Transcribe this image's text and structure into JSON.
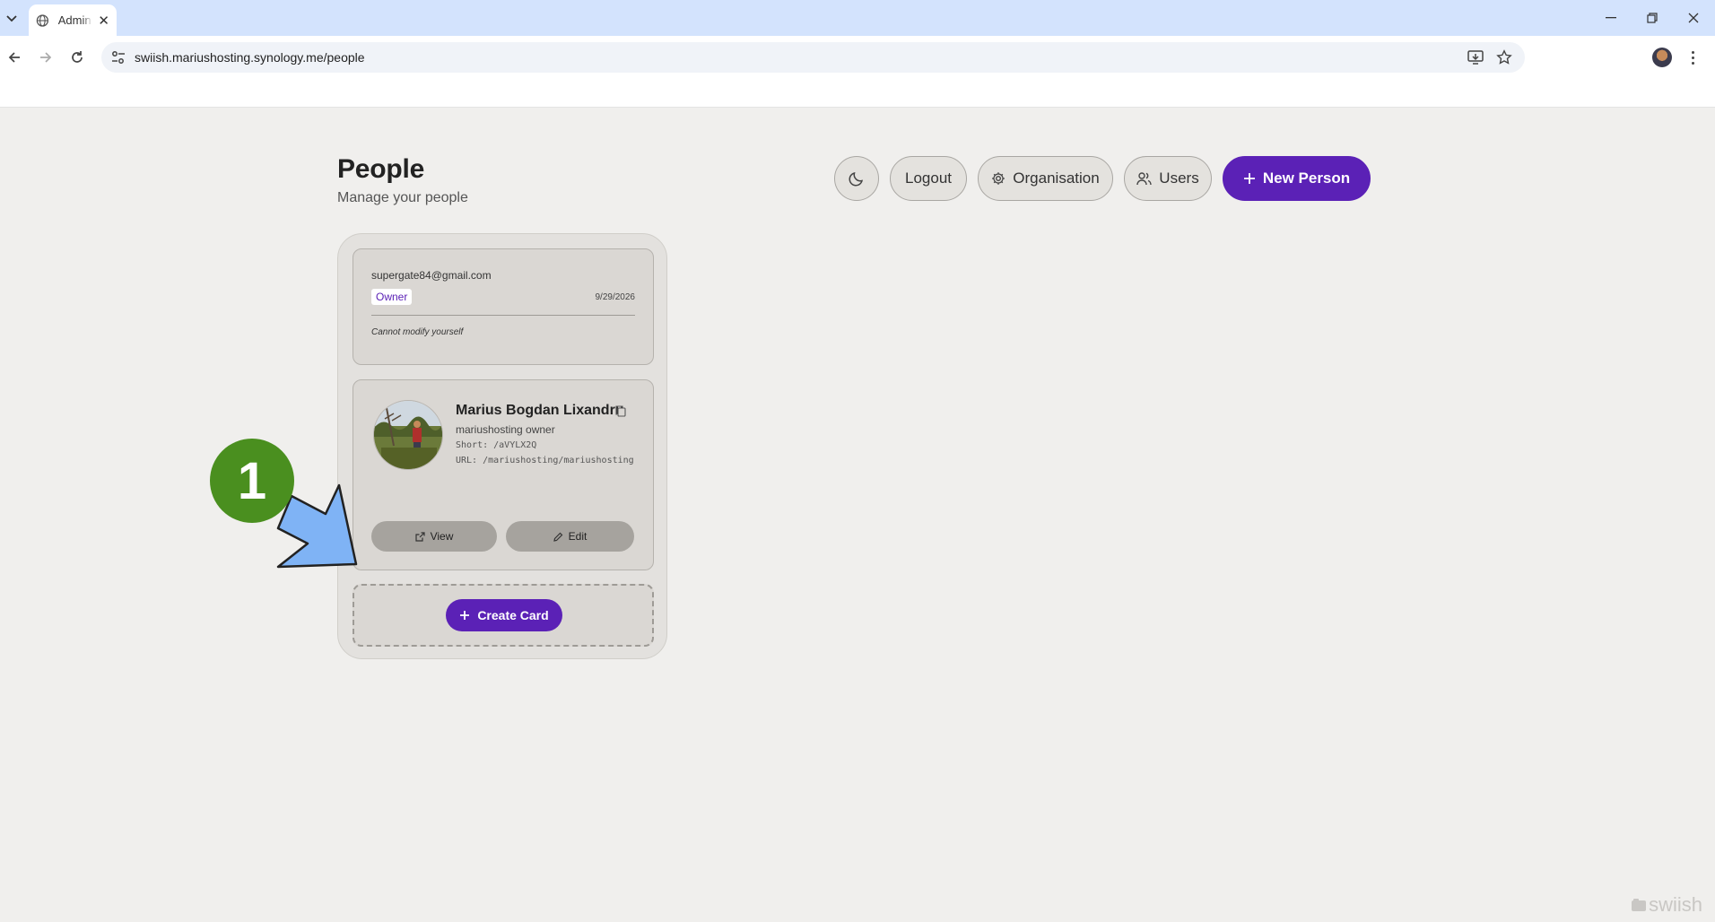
{
  "browser": {
    "tab_title": "Admin",
    "url": "swiish.mariushosting.synology.me/people"
  },
  "header": {
    "title": "People",
    "subtitle": "Manage your people",
    "buttons": {
      "logout": "Logout",
      "organisation": "Organisation",
      "users": "Users",
      "new_person": "New Person"
    }
  },
  "user_card": {
    "email": "supergate84@gmail.com",
    "role": "Owner",
    "date": "9/29/2026",
    "note": "Cannot modify yourself"
  },
  "person_card": {
    "name": "Marius Bogdan Lixandru",
    "title": "mariushosting owner",
    "short": "Short: /aVYLX2Q",
    "url": "URL: /mariushosting/mariushosting",
    "view_label": "View",
    "edit_label": "Edit"
  },
  "create_card": {
    "label": "Create Card"
  },
  "annotation": {
    "step": "1"
  },
  "watermark": "swiish",
  "colors": {
    "accent": "#5b21b6",
    "annotation_circle": "#4a8f1f",
    "annotation_arrow": "#7fb3f5"
  }
}
